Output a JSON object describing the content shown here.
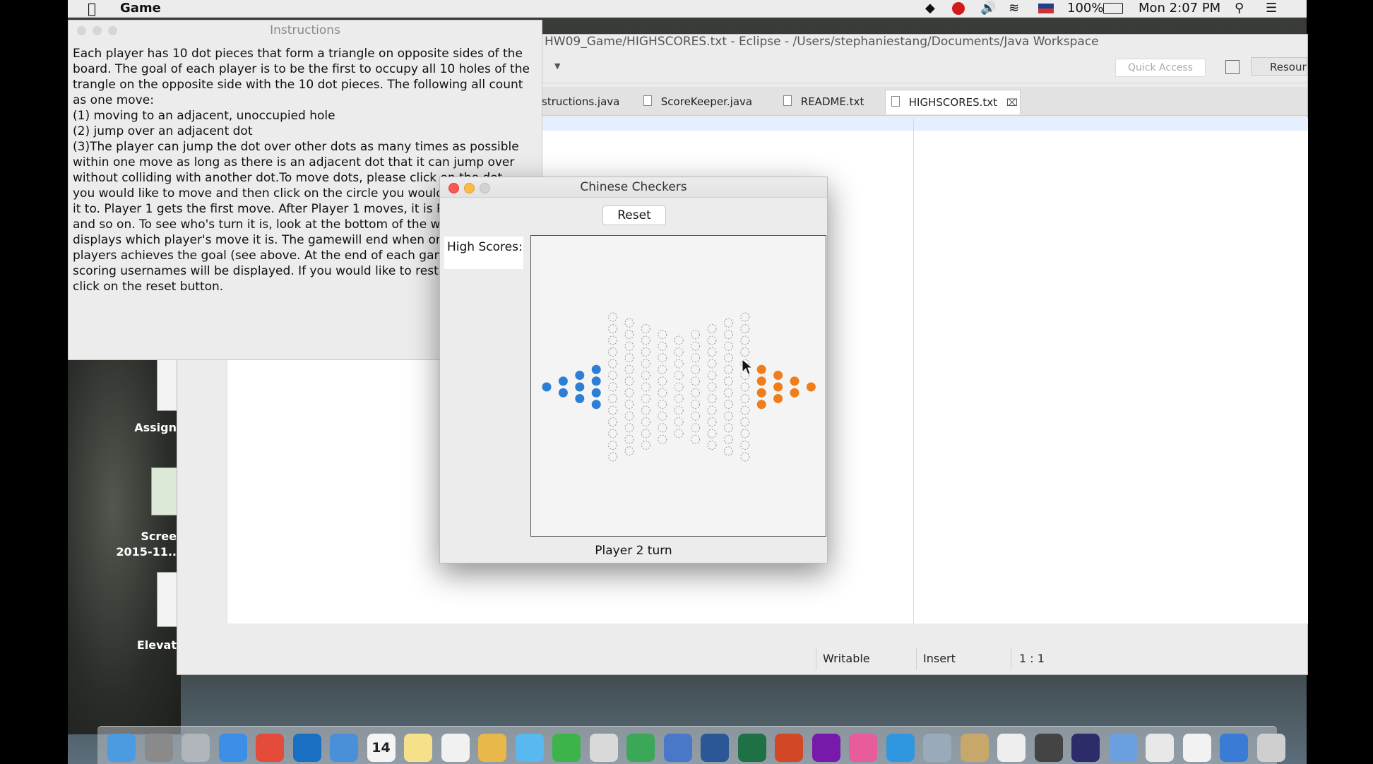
{
  "menubar": {
    "apple_icon": "apple-icon",
    "app_name": "Game",
    "battery": "100%",
    "clock": "Mon 2:07 PM"
  },
  "eclipse": {
    "title": "HW09_Game/HIGHSCORES.txt - Eclipse - /Users/stephaniestang/Documents/Java Workspace",
    "quick_access": "Quick Access",
    "resource_label": "Resour",
    "tabs": [
      {
        "label": "structions.java"
      },
      {
        "label": "ScoreKeeper.java"
      },
      {
        "label": "README.txt"
      },
      {
        "label": "HIGHSCORES.txt"
      }
    ],
    "status": {
      "writable": "Writable",
      "insert": "Insert",
      "position": "1 : 1"
    }
  },
  "desktop": {
    "icons": [
      {
        "label": "Assign"
      },
      {
        "label": "Scree"
      },
      {
        "label": "2015-11.."
      },
      {
        "label": "Elevat"
      }
    ]
  },
  "instructions": {
    "title": "Instructions",
    "text": "Each player has 10 dot pieces that form a triangle on opposite sides of the\nboard. The goal of each player is to be the first to occupy all 10 holes of the\ntrangle on the opposite side with the 10 dot pieces. The following all count\nas one move:\n(1) moving to an adjacent, unoccupied hole\n(2) jump over an adjacent dot\n(3)The player can jump the dot over other dots as many times as possible\nwithin one move as long as there is an adjacent dot that it can jump over\nwithout colliding with another dot.To move dots, please click on the dot\nyou would like to move and then click on the circle you would like to move\nit to. Player 1 gets the first move. After Player 1 moves, it is Player 2's turn\nand so on. To see who's turn it is, look at the bottom of the window, which\ndisplays which player's move it is. The gamewill end when one of the\nplayers achieves the goal (see above. At the end of each game, the top\nscoring usernames will be displayed. If you would like to restart the game,\nclick on the reset button."
  },
  "game": {
    "title": "Chinese Checkers",
    "reset_label": "Reset",
    "high_scores_label": "High Scores:",
    "turn_text": "Player 2 turn",
    "colors": {
      "player1": "#2d7fd6",
      "player2": "#ef7d1a",
      "empty": "#9a9a9a"
    },
    "board": {
      "columns": 17,
      "cells_per_column": [
        1,
        2,
        3,
        4,
        13,
        12,
        11,
        10,
        9,
        10,
        11,
        12,
        13,
        4,
        3,
        2,
        1
      ],
      "player1_pieces": [
        [
          0,
          0
        ],
        [
          1,
          0
        ],
        [
          1,
          1
        ],
        [
          2,
          0
        ],
        [
          2,
          1
        ],
        [
          2,
          2
        ],
        [
          3,
          0
        ],
        [
          3,
          1
        ],
        [
          3,
          2
        ],
        [
          3,
          3
        ]
      ],
      "player2_pieces": [
        [
          16,
          0
        ],
        [
          15,
          0
        ],
        [
          15,
          1
        ],
        [
          14,
          0
        ],
        [
          14,
          1
        ],
        [
          14,
          2
        ],
        [
          13,
          0
        ],
        [
          13,
          1
        ],
        [
          13,
          2
        ],
        [
          13,
          3
        ]
      ]
    }
  },
  "dock": {
    "icons": [
      "finder-icon",
      "system-preferences-icon",
      "launchpad-icon",
      "safari-icon",
      "chrome-icon",
      "outlook-icon",
      "mail-icon",
      "calendar-icon",
      "notes-icon",
      "reminders-icon",
      "photos-icon",
      "messages-icon",
      "facetime-icon",
      "preview-icon",
      "numbers-icon",
      "keynote-icon",
      "word-icon",
      "excel-icon",
      "powerpoint-icon",
      "onenote-icon",
      "itunes-icon",
      "app-store-icon",
      "preview-2-icon",
      "contacts-icon",
      "textedit-icon",
      "sublime-icon",
      "eclipse-icon",
      "remote-desktop-icon",
      "java-icon",
      "document-icon",
      "downloads-icon",
      "trash-icon"
    ],
    "calendar_day": "14"
  }
}
